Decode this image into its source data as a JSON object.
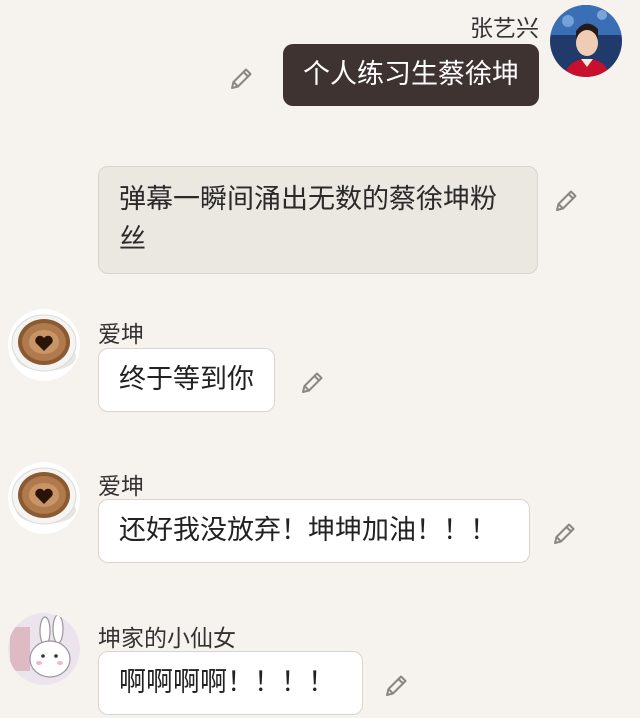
{
  "messages": [
    {
      "sender": "张艺兴",
      "text": "个人练习生蔡徐坤",
      "style": "dark",
      "avatar_icon": "person-photo-icon"
    },
    {
      "sender": "",
      "text": "弹幕一瞬间涌出无数的蔡徐坤粉丝",
      "style": "narration"
    },
    {
      "sender": "爱坤",
      "text": "终于等到你",
      "style": "white",
      "avatar_icon": "coffee-heart-icon"
    },
    {
      "sender": "爱坤",
      "text": "还好我没放弃！坤坤加油！！！",
      "style": "white",
      "avatar_icon": "coffee-heart-icon"
    },
    {
      "sender": "坤家的小仙女",
      "text": "啊啊啊啊！！！！",
      "style": "white",
      "avatar_icon": "bunny-icon"
    }
  ],
  "colors": {
    "background": "#f6f3ee",
    "dark_bubble": "#3e3330",
    "narration_bubble": "#ebe7e1",
    "white_bubble": "#ffffff",
    "edit_icon": "#8a8682"
  }
}
